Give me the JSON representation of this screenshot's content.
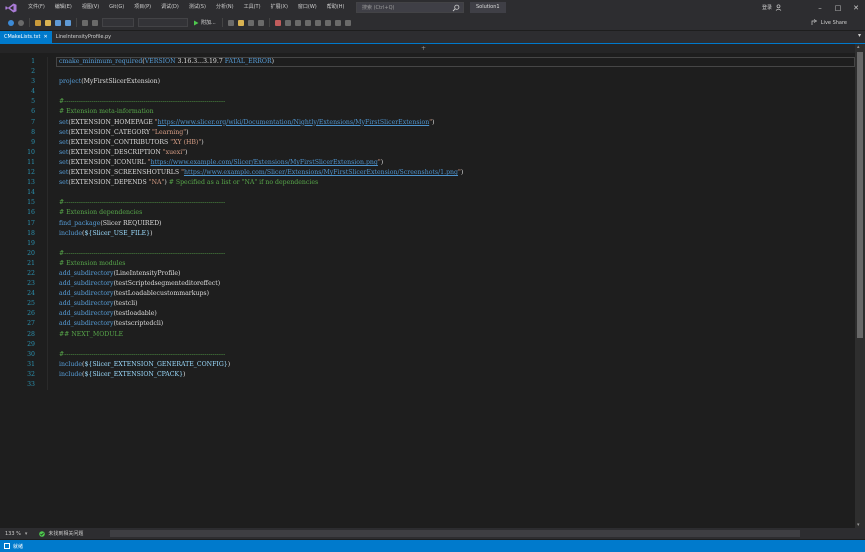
{
  "menu": {
    "items": [
      "文件(F)",
      "编辑(E)",
      "视图(V)",
      "Git(G)",
      "项目(P)",
      "调试(D)",
      "测试(S)",
      "分析(N)",
      "工具(T)",
      "扩展(X)",
      "窗口(W)",
      "帮助(H)"
    ],
    "search_placeholder": "搜索 (Ctrl+Q)",
    "solution": "Solution1",
    "login": "登录"
  },
  "toolbar": {
    "run_label": "附加...",
    "live_share": "Live Share"
  },
  "tabs": [
    {
      "label": "CMakeLists.txt",
      "active": true
    },
    {
      "label": "LineIntensityProfile.py",
      "active": false
    }
  ],
  "editor": {
    "line_numbers": [
      "1",
      "2",
      "3",
      "4",
      "5",
      "6",
      "7",
      "8",
      "9",
      "10",
      "11",
      "12",
      "13",
      "14",
      "15",
      "16",
      "17",
      "18",
      "19",
      "20",
      "21",
      "22",
      "23",
      "24",
      "25",
      "26",
      "27",
      "28",
      "29",
      "30",
      "31",
      "32",
      "33"
    ],
    "lines": [
      [
        [
          "fn",
          "cmake_minimum_required"
        ],
        [
          "arg",
          "("
        ],
        [
          "fn",
          "VERSION"
        ],
        [
          "arg",
          " 3.16.3...3.19.7 "
        ],
        [
          "fn",
          "FATAL_ERROR"
        ],
        [
          "arg",
          ")"
        ]
      ],
      [],
      [
        [
          "fn",
          "project"
        ],
        [
          "arg",
          "(MyFirstSlicerExtension)"
        ]
      ],
      [],
      [
        [
          "cmt",
          "#-----------------------------------------------------------------------------"
        ]
      ],
      [
        [
          "cmt",
          "# Extension meta-information"
        ]
      ],
      [
        [
          "fn",
          "set"
        ],
        [
          "arg",
          "(EXTENSION_HOMEPAGE "
        ],
        [
          "str",
          "\""
        ],
        [
          "url",
          "https://www.slicer.org/wiki/Documentation/Nightly/Extensions/MyFirstSlicerExtension"
        ],
        [
          "str",
          "\""
        ],
        [
          "arg",
          ")"
        ]
      ],
      [
        [
          "fn",
          "set"
        ],
        [
          "arg",
          "(EXTENSION_CATEGORY "
        ],
        [
          "str",
          "\"Learning\""
        ],
        [
          "arg",
          ")"
        ]
      ],
      [
        [
          "fn",
          "set"
        ],
        [
          "arg",
          "(EXTENSION_CONTRIBUTORS "
        ],
        [
          "str",
          "\"XY (HB)\""
        ],
        [
          "arg",
          ")"
        ]
      ],
      [
        [
          "fn",
          "set"
        ],
        [
          "arg",
          "(EXTENSION_DESCRIPTION "
        ],
        [
          "str",
          "\"xuexi\""
        ],
        [
          "arg",
          ")"
        ]
      ],
      [
        [
          "fn",
          "set"
        ],
        [
          "arg",
          "(EXTENSION_ICONURL "
        ],
        [
          "str",
          "\""
        ],
        [
          "url",
          "https://www.example.com/Slicer/Extensions/MyFirstSlicerExtension.png"
        ],
        [
          "str",
          "\""
        ],
        [
          "arg",
          ")"
        ]
      ],
      [
        [
          "fn",
          "set"
        ],
        [
          "arg",
          "(EXTENSION_SCREENSHOTURLS "
        ],
        [
          "str",
          "\""
        ],
        [
          "url",
          "https://www.example.com/Slicer/Extensions/MyFirstSlicerExtension/Screenshots/1.png"
        ],
        [
          "str",
          "\""
        ],
        [
          "arg",
          ")"
        ]
      ],
      [
        [
          "fn",
          "set"
        ],
        [
          "arg",
          "(EXTENSION_DEPENDS "
        ],
        [
          "str",
          "\"NA\""
        ],
        [
          "arg",
          ") "
        ],
        [
          "cmt",
          "# Specified as a list or \"NA\" if no dependencies"
        ]
      ],
      [],
      [
        [
          "cmt",
          "#-----------------------------------------------------------------------------"
        ]
      ],
      [
        [
          "cmt",
          "# Extension dependencies"
        ]
      ],
      [
        [
          "fn",
          "find_package"
        ],
        [
          "arg",
          "(Slicer REQUIRED)"
        ]
      ],
      [
        [
          "fn",
          "include"
        ],
        [
          "arg",
          "("
        ],
        [
          "var",
          "${Slicer_USE_FILE}"
        ],
        [
          "arg",
          ")"
        ]
      ],
      [],
      [
        [
          "cmt",
          "#-----------------------------------------------------------------------------"
        ]
      ],
      [
        [
          "cmt",
          "# Extension modules"
        ]
      ],
      [
        [
          "fn",
          "add_subdirectory"
        ],
        [
          "arg",
          "(LineIntensityProfile)"
        ]
      ],
      [
        [
          "fn",
          "add_subdirectory"
        ],
        [
          "arg",
          "(testScriptedsegmenteditoreffect)"
        ]
      ],
      [
        [
          "fn",
          "add_subdirectory"
        ],
        [
          "arg",
          "(testLoadablecustommarkups)"
        ]
      ],
      [
        [
          "fn",
          "add_subdirectory"
        ],
        [
          "arg",
          "(testcli)"
        ]
      ],
      [
        [
          "fn",
          "add_subdirectory"
        ],
        [
          "arg",
          "(testloadable)"
        ]
      ],
      [
        [
          "fn",
          "add_subdirectory"
        ],
        [
          "arg",
          "(testscriptedcli)"
        ]
      ],
      [
        [
          "cmt",
          "## NEXT_MODULE"
        ]
      ],
      [],
      [
        [
          "cmt",
          "#-----------------------------------------------------------------------------"
        ]
      ],
      [
        [
          "fn",
          "include"
        ],
        [
          "arg",
          "("
        ],
        [
          "var",
          "${Slicer_EXTENSION_GENERATE_CONFIG}"
        ],
        [
          "arg",
          ")"
        ]
      ],
      [
        [
          "fn",
          "include"
        ],
        [
          "arg",
          "("
        ],
        [
          "var",
          "${Slicer_EXTENSION_CPACK}"
        ],
        [
          "arg",
          ")"
        ]
      ],
      []
    ]
  },
  "footer": {
    "zoom": "133 %",
    "issues": "未找到相关问题"
  },
  "status": {
    "text": "就绪"
  },
  "colors": {
    "accent": "#007acc",
    "keyword": "#569cd6",
    "string": "#d69d85",
    "comment": "#57a64a",
    "line_number": "#2b91af"
  }
}
